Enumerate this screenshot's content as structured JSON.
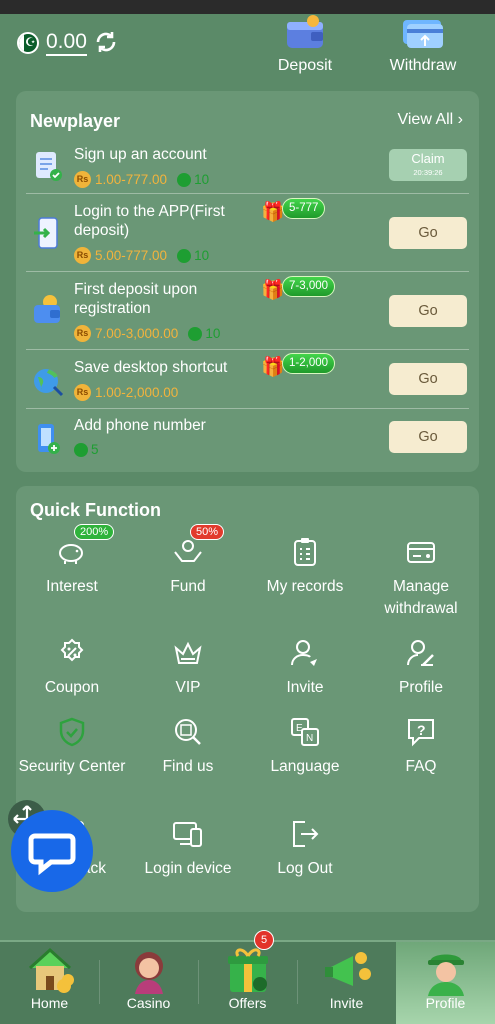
{
  "header": {
    "balance": "0.00",
    "deposit_label": "Deposit",
    "withdraw_label": "Withdraw"
  },
  "newplayer": {
    "title": "Newplayer",
    "view_all": "View All",
    "tasks": [
      {
        "title": "Sign up an account",
        "rs_badge": "Rs",
        "reward": "1.00-777.00",
        "points": "10",
        "button": "Claim",
        "timer": "20:39:26"
      },
      {
        "title": "Login to the APP(First deposit)",
        "rs_badge": "Rs",
        "reward": "5.00-777.00",
        "points": "10",
        "gift": "5-777",
        "button": "Go"
      },
      {
        "title": "First deposit upon registration",
        "rs_badge": "Rs",
        "reward": "7.00-3,000.00",
        "points": "10",
        "gift": "7-3,000",
        "button": "Go"
      },
      {
        "title": "Save desktop shortcut",
        "rs_badge": "Rs",
        "reward": "1.00-2,000.00",
        "gift": "1-2,000",
        "button": "Go"
      },
      {
        "title": "Add phone number",
        "points": "5",
        "button": "Go"
      }
    ]
  },
  "quick": {
    "title": "Quick Function",
    "items": [
      {
        "label": "Interest",
        "icon": "piggy-bank-icon",
        "badge": "200%"
      },
      {
        "label": "Fund",
        "icon": "hands-coin-icon",
        "badge": "50%"
      },
      {
        "label": "My records",
        "icon": "clipboard-icon"
      },
      {
        "label": "Manage withdrawal",
        "icon": "card-icon"
      },
      {
        "label": "Coupon",
        "icon": "coupon-icon"
      },
      {
        "label": "VIP",
        "icon": "crown-icon"
      },
      {
        "label": "Invite",
        "icon": "invite-user-icon"
      },
      {
        "label": "Profile",
        "icon": "profile-edit-icon"
      },
      {
        "label": "Security Center",
        "icon": "shield-icon"
      },
      {
        "label": "Find us",
        "icon": "find-icon"
      },
      {
        "label": "Language",
        "icon": "language-icon"
      },
      {
        "label": "FAQ",
        "icon": "faq-icon"
      },
      {
        "label": "Feedback",
        "icon": "feedback-icon"
      },
      {
        "label": "Login device",
        "icon": "devices-icon"
      },
      {
        "label": "Log Out",
        "icon": "logout-icon"
      }
    ]
  },
  "nav": {
    "items": [
      {
        "label": "Home",
        "icon": "home-icon"
      },
      {
        "label": "Casino",
        "icon": "casino-girl-icon"
      },
      {
        "label": "Offers",
        "icon": "gift-icon",
        "badge": "5"
      },
      {
        "label": "Invite",
        "icon": "megaphone-icon"
      },
      {
        "label": "Profile",
        "icon": "avatar-icon"
      }
    ],
    "active": "Profile"
  },
  "colors": {
    "background": "#5b8a68",
    "panel": "#6a9776",
    "reward_gold": "#f2b33d",
    "points_green": "#1e9e32",
    "go_button": "#f6ecd0",
    "chat_blue": "#1868e8"
  }
}
